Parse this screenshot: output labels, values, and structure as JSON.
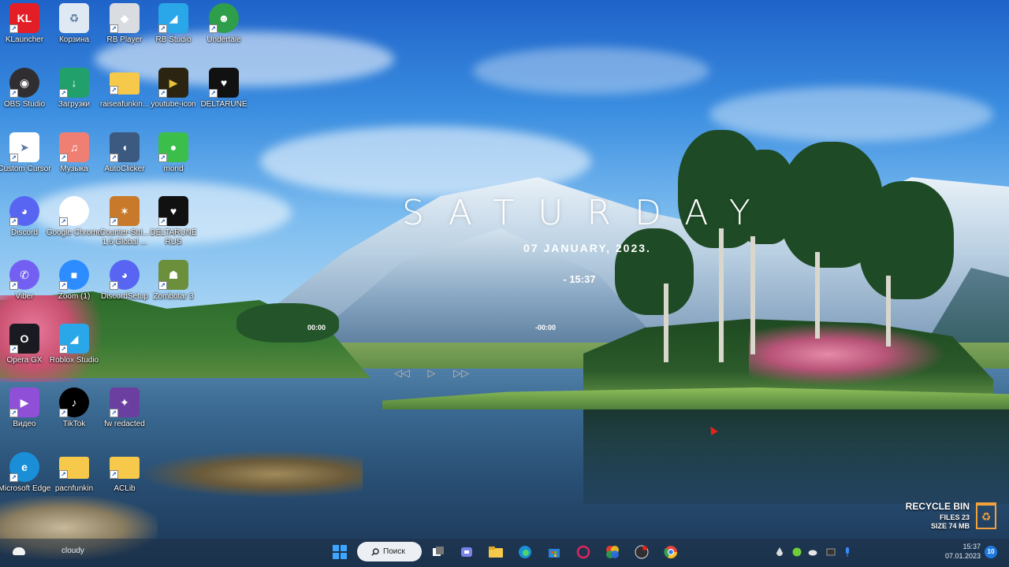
{
  "desktop_icons": [
    {
      "label": "KLauncher",
      "icon": "klauncher-icon",
      "color": "#e41e26",
      "glyph": "KL"
    },
    {
      "label": "Корзина",
      "icon": "recycle-bin-icon",
      "color": "#dfe9f3",
      "glyph": "♻"
    },
    {
      "label": "RB Player",
      "icon": "roblox-player-icon",
      "color": "#d9dde2",
      "glyph": "◆"
    },
    {
      "label": "RB Studio",
      "icon": "roblox-studio-icon",
      "color": "#2aa7e8",
      "glyph": "◢"
    },
    {
      "label": "Undertale",
      "icon": "undertale-icon",
      "color": "#2f9e4a",
      "glyph": "☻"
    },
    {
      "label": "OBS Studio",
      "icon": "obs-icon",
      "color": "#302e31",
      "glyph": "◉"
    },
    {
      "label": "Загрузки",
      "icon": "downloads-folder-icon",
      "color": "#22a06b",
      "glyph": "↓"
    },
    {
      "label": "raiseafunkin...",
      "icon": "folder-icon",
      "color": "#f6c94b",
      "glyph": ""
    },
    {
      "label": "youtube-icon",
      "icon": "youtube-icon",
      "color": "#2b2410",
      "glyph": "▶"
    },
    {
      "label": "DELTARUNE",
      "icon": "deltarune-icon",
      "color": "#111111",
      "glyph": "♥"
    },
    {
      "label": "Custom Cursor",
      "icon": "custom-cursor-icon",
      "color": "#ffffff",
      "glyph": "➤"
    },
    {
      "label": "Музыка",
      "icon": "music-folder-icon",
      "color": "#f07f73",
      "glyph": "♫"
    },
    {
      "label": "AutoClicker",
      "icon": "mouse-icon",
      "color": "#3c5a80",
      "glyph": "◖"
    },
    {
      "label": "mond",
      "icon": "mond-icon",
      "color": "#3cbf4a",
      "glyph": "●"
    },
    {
      "label": "Discord",
      "icon": "discord-icon",
      "color": "#5865f2",
      "glyph": "◕"
    },
    {
      "label": "Google Chrome",
      "icon": "chrome-icon",
      "color": "#ffffff",
      "glyph": "◎"
    },
    {
      "label": "Counter-Stri... 1.6 Global ...",
      "icon": "counter-strike-icon",
      "color": "#c87a2a",
      "glyph": "✶"
    },
    {
      "label": "DELTARUNE RUS",
      "icon": "deltarune-rus-icon",
      "color": "#111111",
      "glyph": "♥"
    },
    {
      "label": "Viber",
      "icon": "viber-icon",
      "color": "#7360f2",
      "glyph": "✆"
    },
    {
      "label": "Zoom (1)",
      "icon": "zoom-icon",
      "color": "#2d8cff",
      "glyph": "■"
    },
    {
      "label": "DiscordSetup",
      "icon": "discord-setup-icon",
      "color": "#5865f2",
      "glyph": "◕"
    },
    {
      "label": "Zombotar 3",
      "icon": "zombotar-icon",
      "color": "#6b8f3a",
      "glyph": "☗"
    },
    {
      "label": "Opera GX",
      "icon": "opera-gx-icon",
      "color": "#1a1a22",
      "glyph": "O"
    },
    {
      "label": "Roblox Studio",
      "icon": "roblox-studio-2-icon",
      "color": "#2aa7e8",
      "glyph": "◢"
    },
    {
      "label": "Видео",
      "icon": "video-folder-icon",
      "color": "#8f4fd6",
      "glyph": "▶"
    },
    {
      "label": "TikTok",
      "icon": "tiktok-icon",
      "color": "#000000",
      "glyph": "♪"
    },
    {
      "label": "fw redacted",
      "icon": "fnaf-world-icon",
      "color": "#6b3fa0",
      "glyph": "✦"
    },
    {
      "label": "Microsoft Edge",
      "icon": "edge-icon",
      "color": "#1a8fd8",
      "glyph": "e"
    },
    {
      "label": "pacnfunkin",
      "icon": "folder-icon",
      "color": "#f6c94b",
      "glyph": ""
    },
    {
      "label": "ACLib",
      "icon": "folder-icon",
      "color": "#f6c94b",
      "glyph": ""
    }
  ],
  "clock": {
    "day": "SATURDAY",
    "date": "07  JANUARY,  2023.",
    "time": "- 15:37",
    "media_elapsed": "00:00",
    "media_total": "-00:00"
  },
  "recycle_widget": {
    "title": "RECYCLE BIN",
    "files": "FILES 23",
    "size": "SIZE 74 MB"
  },
  "taskbar": {
    "weather_text": "cloudy",
    "search_label": "Поиск",
    "clock_time": "15:37",
    "clock_date": "07.01.2023",
    "notification_count": "10"
  },
  "colors": {
    "accent": "#1f7ae0",
    "widget_orange": "#f2a23a"
  }
}
